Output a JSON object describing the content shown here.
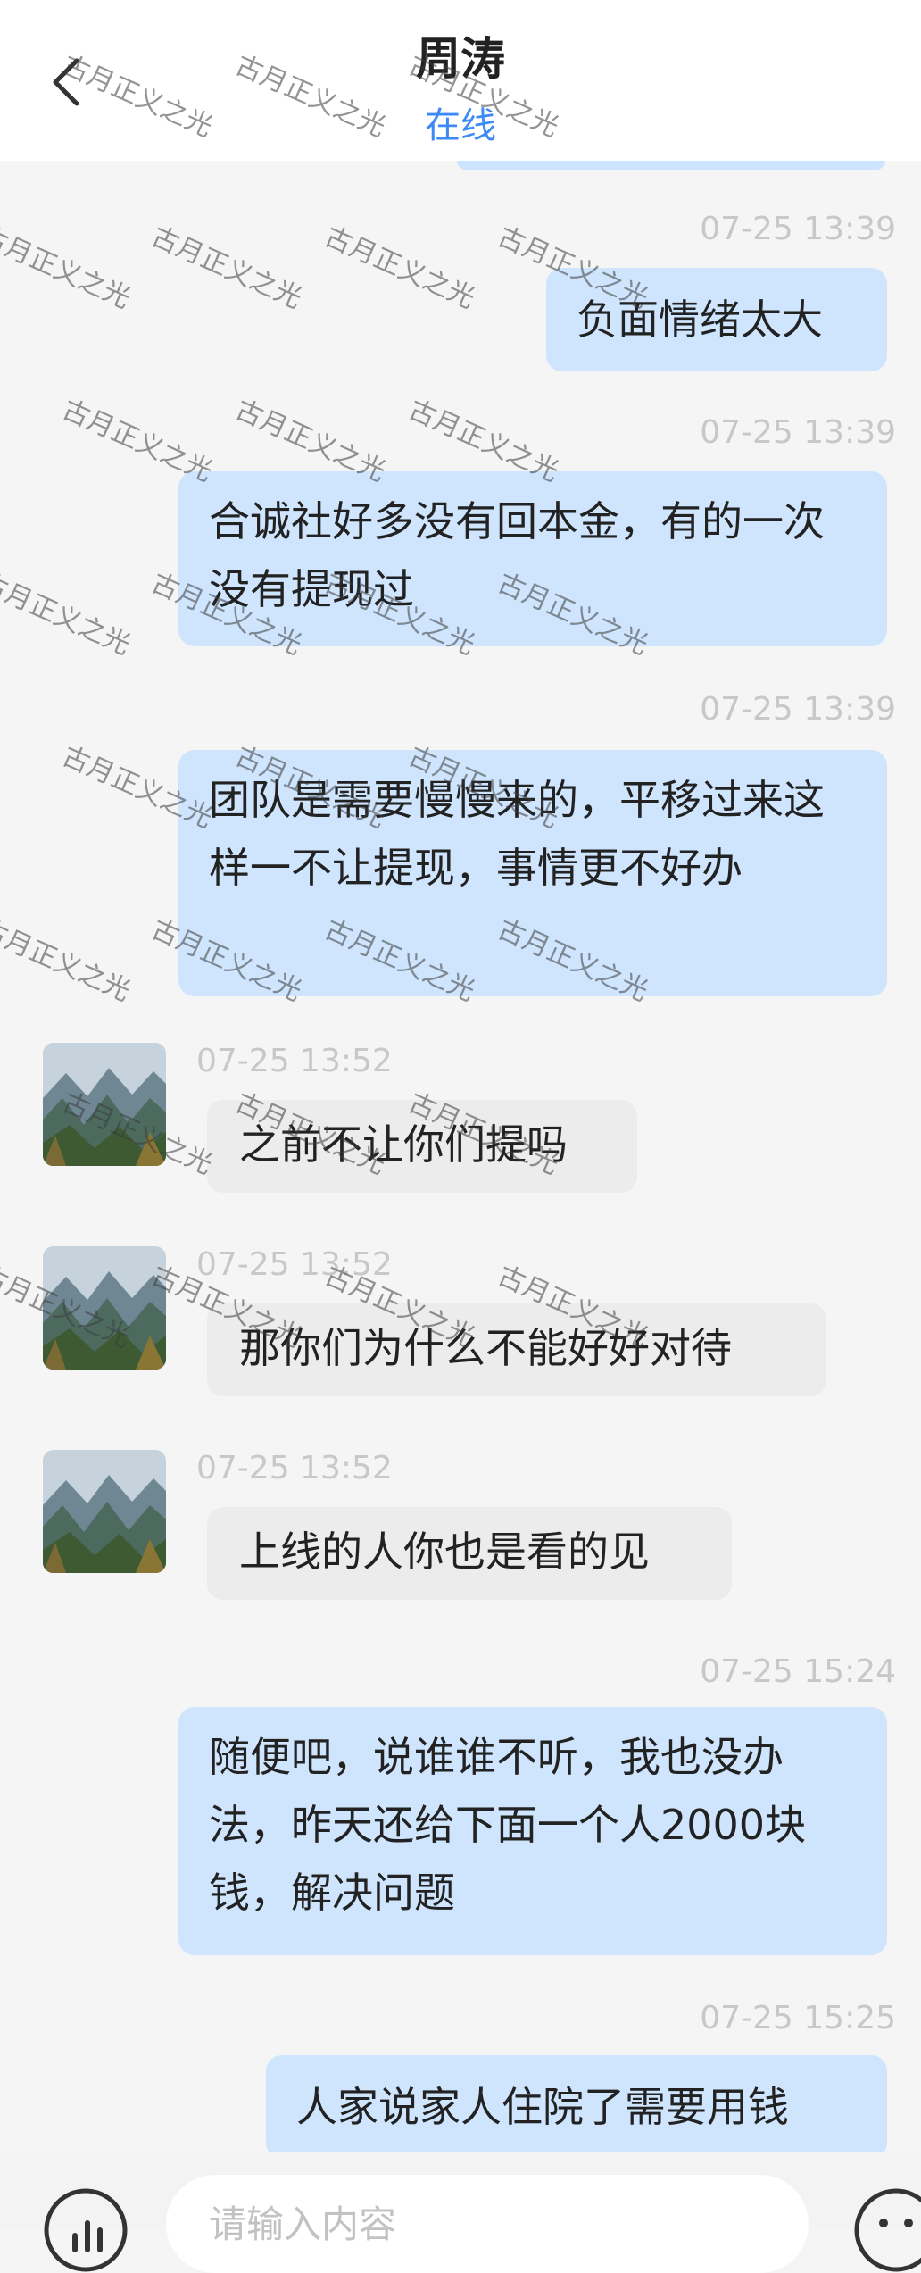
{
  "header": {
    "title": "周涛",
    "status": "在线"
  },
  "messages": [
    {
      "timestamp": "07-25 13:39",
      "direction": "outgoing",
      "text": "负面情绪太大"
    },
    {
      "timestamp": "07-25 13:39",
      "direction": "outgoing",
      "text": "合诚社好多没有回本金，有的一次没有提现过"
    },
    {
      "timestamp": "07-25 13:39",
      "direction": "outgoing",
      "text": "团队是需要慢慢来的，平移过来这样一不让提现，事情更不好办"
    },
    {
      "timestamp": "07-25 13:52",
      "direction": "incoming",
      "text": "之前不让你们提吗"
    },
    {
      "timestamp": "07-25 13:52",
      "direction": "incoming",
      "text": "那你们为什么不能好好对待"
    },
    {
      "timestamp": "07-25 13:52",
      "direction": "incoming",
      "text": "上线的人你也是看的见"
    },
    {
      "timestamp": "07-25 15:24",
      "direction": "outgoing",
      "text": "随便吧，说谁谁不听，我也没办法，昨天还给下面一个人2000块钱，解决问题"
    },
    {
      "timestamp": "07-25 15:25",
      "direction": "outgoing",
      "text": "人家说家人住院了需要用钱"
    }
  ],
  "watermark": "古月正义之光",
  "composer": {
    "placeholder": "请输入内容"
  },
  "colors": {
    "outgoing_bubble": "#cfe4fd",
    "incoming_bubble": "#ececec",
    "status_online": "#3d8af7",
    "timestamp": "#c8c8c8"
  },
  "icons": [
    "back-arrow-icon",
    "voice-icon",
    "emoji-icon"
  ]
}
